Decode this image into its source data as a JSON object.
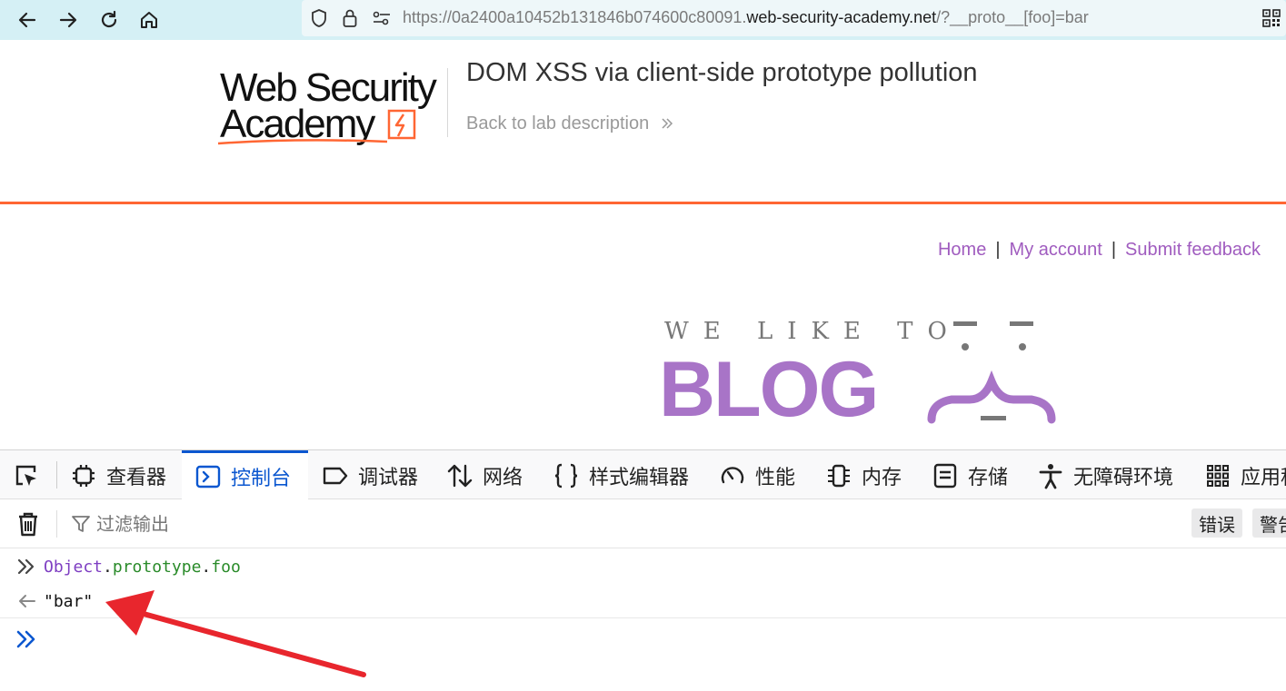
{
  "browser": {
    "url_prefix": "https://0a2400a10452b131846b074600c80091.",
    "url_domain": "web-security-academy.net",
    "url_suffix": "/?__proto__[foo]=bar"
  },
  "header": {
    "logo_line1": "Web Security",
    "logo_line2": "Academy",
    "lab_title": "DOM XSS via client-side prototype pollution",
    "back_link": "Back to lab description"
  },
  "site_nav": {
    "home": "Home",
    "sep": "|",
    "my_account": "My account",
    "submit_feedback": "Submit feedback"
  },
  "banner": {
    "tagline": "WE LIKE TO",
    "word": "BLOG"
  },
  "devtools": {
    "tabs": [
      "查看器",
      "控制台",
      "调试器",
      "网络",
      "样式编辑器",
      "性能",
      "内存",
      "存储",
      "无障碍环境",
      "应用程"
    ],
    "active_tab": "控制台",
    "filter_placeholder": "过滤输出",
    "level_buttons": [
      "错误",
      "警告"
    ]
  },
  "console": {
    "input_object": "Object",
    "input_dot": ".",
    "input_prototype": "prototype",
    "input_foo": "foo",
    "output": "\"bar\""
  },
  "colors": {
    "accent_orange": "#ff6633",
    "link_purple": "#a05cbf",
    "blog_purple": "#a874c7",
    "devtools_blue": "#0b57d0",
    "arrow_red": "#e8262d"
  }
}
